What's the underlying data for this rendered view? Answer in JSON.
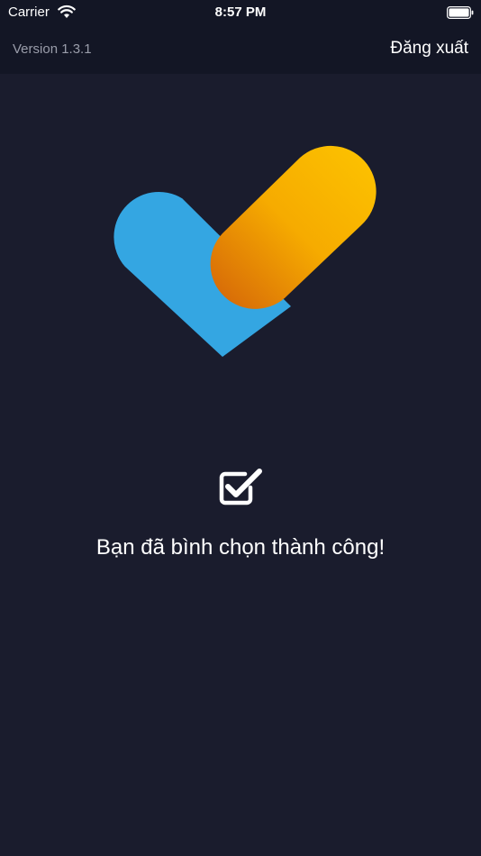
{
  "status_bar": {
    "carrier": "Carrier",
    "time": "8:57 PM"
  },
  "nav_bar": {
    "version": "Version 1.3.1",
    "logout_label": "Đăng xuất"
  },
  "content": {
    "message": "Bạn đã bình chọn thành công!"
  },
  "icons": {
    "wifi": "wifi-icon",
    "battery": "battery-icon",
    "logo": "app-logo",
    "check": "checkbox-checked-icon"
  },
  "colors": {
    "background": "#1a1c2d",
    "bar_background": "#131625",
    "logo_blue": "#34a6e2",
    "logo_yellow": "#fdc400",
    "logo_orange": "#d86a0c"
  }
}
